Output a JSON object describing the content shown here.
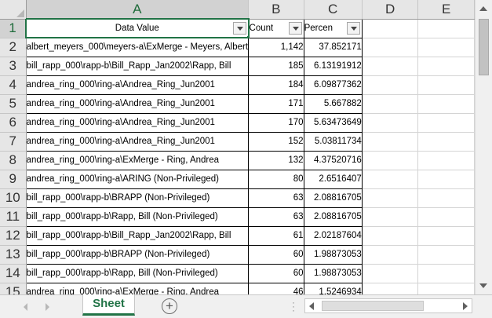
{
  "columns": [
    "A",
    "B",
    "C",
    "D",
    "E"
  ],
  "header_row": {
    "row_number": "1",
    "a": "Data Value",
    "b": "Count",
    "c": "Percen"
  },
  "rows": [
    {
      "num": "2",
      "a": "albert_meyers_000\\meyers-a\\ExMerge - Meyers, Albert",
      "b": "1,142",
      "c": "37.852171"
    },
    {
      "num": "3",
      "a": "bill_rapp_000\\rapp-b\\Bill_Rapp_Jan2002\\Rapp, Bill",
      "b": "185",
      "c": "6.13191912"
    },
    {
      "num": "4",
      "a": "andrea_ring_000\\ring-a\\Andrea_Ring_Jun2001",
      "b": "184",
      "c": "6.09877362"
    },
    {
      "num": "5",
      "a": "andrea_ring_000\\ring-a\\Andrea_Ring_Jun2001",
      "b": "171",
      "c": "5.667882"
    },
    {
      "num": "6",
      "a": "andrea_ring_000\\ring-a\\Andrea_Ring_Jun2001",
      "b": "170",
      "c": "5.63473649"
    },
    {
      "num": "7",
      "a": "andrea_ring_000\\ring-a\\Andrea_Ring_Jun2001",
      "b": "152",
      "c": "5.03811734"
    },
    {
      "num": "8",
      "a": "andrea_ring_000\\ring-a\\ExMerge - Ring, Andrea",
      "b": "132",
      "c": "4.37520716"
    },
    {
      "num": "9",
      "a": "andrea_ring_000\\ring-a\\ARING (Non-Privileged)",
      "b": "80",
      "c": "2.6516407"
    },
    {
      "num": "10",
      "a": "bill_rapp_000\\rapp-b\\BRAPP (Non-Privileged)",
      "b": "63",
      "c": "2.08816705"
    },
    {
      "num": "11",
      "a": "bill_rapp_000\\rapp-b\\Rapp, Bill (Non-Privileged)",
      "b": "63",
      "c": "2.08816705"
    },
    {
      "num": "12",
      "a": "bill_rapp_000\\rapp-b\\Bill_Rapp_Jan2002\\Rapp, Bill",
      "b": "61",
      "c": "2.02187604"
    },
    {
      "num": "13",
      "a": "bill_rapp_000\\rapp-b\\BRAPP (Non-Privileged)",
      "b": "60",
      "c": "1.98873053"
    },
    {
      "num": "14",
      "a": "bill_rapp_000\\rapp-b\\Rapp, Bill (Non-Privileged)",
      "b": "60",
      "c": "1.98873053"
    },
    {
      "num": "15",
      "a": "andrea_ring_000\\ring-a\\ExMerge - Ring, Andrea",
      "b": "46",
      "c": "1.5246934"
    }
  ],
  "sheet_tab": "Sheet",
  "add_sheet_symbol": "+"
}
